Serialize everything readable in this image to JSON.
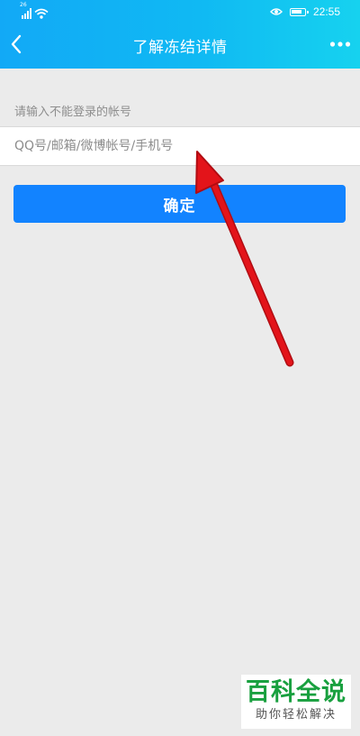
{
  "status_bar": {
    "signal_label": "26",
    "time": "22:55",
    "battery_level": 0.85,
    "icons": [
      "signal-icon",
      "wifi-icon",
      "eye-icon",
      "battery-icon"
    ]
  },
  "nav": {
    "title": "了解冻结详情",
    "back_icon": "chevron-left-icon",
    "more_icon": "more-dots-icon"
  },
  "form": {
    "hint": "请输入不能登录的帐号",
    "account_value": "",
    "account_placeholder": "QQ号/邮箱/微博帐号/手机号",
    "confirm_label": "确定"
  },
  "watermark": {
    "title": "百科全说",
    "subtitle": "助你轻松解决"
  },
  "colors": {
    "header_gradient_start": "#12a9f6",
    "header_gradient_end": "#16d2ef",
    "button_blue": "#1283ff",
    "page_background": "#ebebeb",
    "annotation_arrow": "#e3141a",
    "watermark_green": "#19a03f"
  }
}
